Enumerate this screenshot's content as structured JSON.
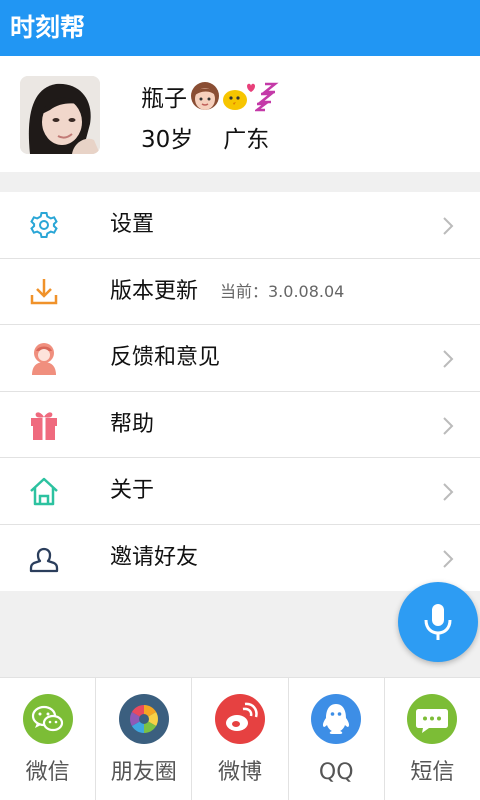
{
  "app": {
    "title": "时刻帮"
  },
  "profile": {
    "name": "瓶子",
    "age": "30岁",
    "region": "广东"
  },
  "menu": [
    {
      "label": "设置",
      "icon": "gear-icon"
    },
    {
      "label": "版本更新",
      "sub": "当前：3.0.08.04",
      "icon": "download-icon"
    },
    {
      "label": "反馈和意见",
      "icon": "feedback-person-icon"
    },
    {
      "label": "帮助",
      "icon": "gift-icon"
    },
    {
      "label": "关于",
      "icon": "home-icon"
    },
    {
      "label": "邀请好友",
      "icon": "invite-user-icon"
    }
  ],
  "share": [
    {
      "label": "微信",
      "icon": "wechat-icon",
      "color": "#7cbd36"
    },
    {
      "label": "朋友圈",
      "icon": "moments-icon",
      "color": "#3b5f7f"
    },
    {
      "label": "微博",
      "icon": "weibo-icon",
      "color": "#e64141"
    },
    {
      "label": "QQ",
      "icon": "qq-icon",
      "color": "#3d8ee6"
    },
    {
      "label": "短信",
      "icon": "sms-icon",
      "color": "#7cbd36"
    }
  ],
  "colors": {
    "appbar": "#2196f3",
    "fab": "#2d9cf3"
  }
}
